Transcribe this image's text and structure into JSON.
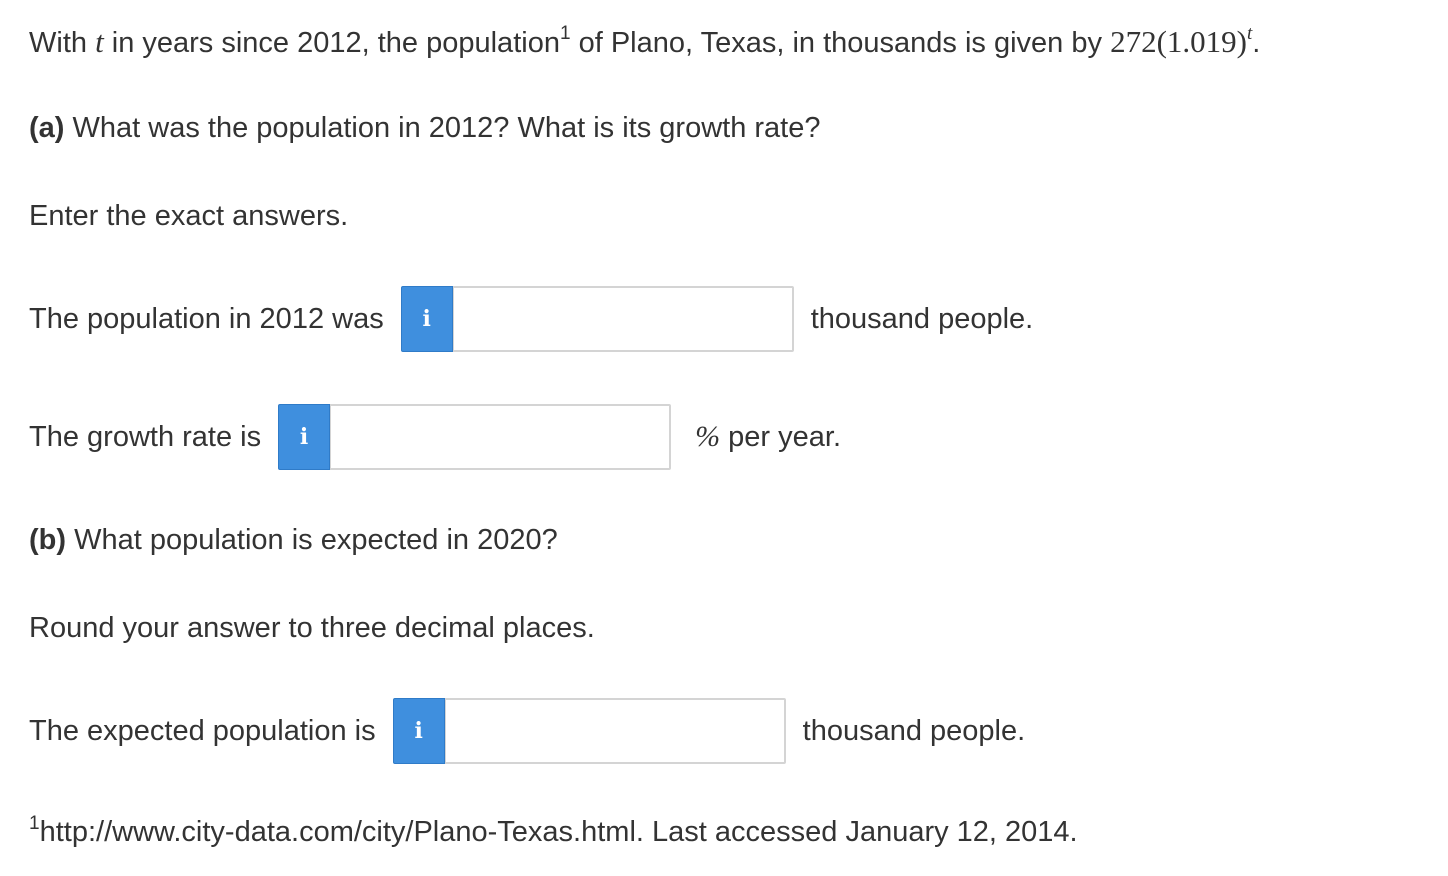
{
  "intro": {
    "prefix": "With",
    "variable": "t",
    "text_before_footnote": "in years since 2012, the population",
    "footnote_mark": "1",
    "text_after_footnote": "of Plano, Texas, in thousands is given by",
    "formula_base": "272(1.019)",
    "formula_exponent": "t",
    "period": "."
  },
  "part_a": {
    "label": "(a)",
    "question": "What was the population in 2012? What is its growth rate?",
    "instruction": "Enter the exact answers.",
    "population_row": {
      "label": "The population in 2012 was",
      "info_icon_glyph": "i",
      "value": "",
      "unit": "thousand people."
    },
    "growth_row": {
      "label": "The growth rate is",
      "info_icon_glyph": "i",
      "value": "",
      "unit_symbol": "%",
      "unit_text": "per year."
    }
  },
  "part_b": {
    "label": "(b)",
    "question": "What population is expected in 2020?",
    "instruction": "Round your answer to three decimal places.",
    "expected_row": {
      "label": "The expected population is",
      "info_icon_glyph": "i",
      "value": "",
      "unit": "thousand people."
    }
  },
  "footnote": {
    "mark": "1",
    "text": "http://www.city-data.com/city/Plano-Texas.html. Last accessed January 12, 2014."
  },
  "colors": {
    "info_button": "#3f8fde",
    "text": "#333333",
    "input_border": "#d4d4d4"
  },
  "icons": {
    "info": "info-icon"
  }
}
